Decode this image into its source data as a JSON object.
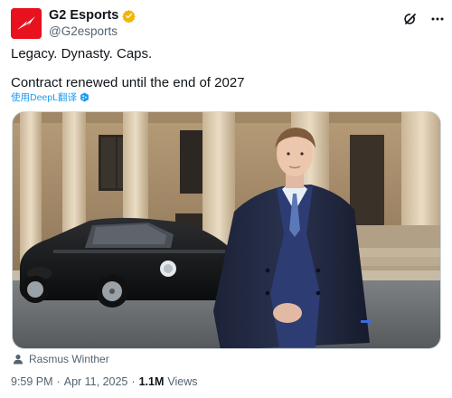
{
  "account": {
    "display_name": "G2 Esports",
    "handle": "@G2esports"
  },
  "tweet": {
    "line1": "Legacy. Dynasty. Caps.",
    "line2": "Contract renewed until the end of 2027",
    "translate_label": "使用DeepL翻译"
  },
  "media": {
    "credit": "Rasmus Winther"
  },
  "footer": {
    "time": "9:59 PM",
    "date": "Apr 11, 2025",
    "separator": "·",
    "views_count": "1.1M",
    "views_label": "Views"
  },
  "icons": {
    "avatar": "g2-logo-icon",
    "verified": "verified-badge-icon",
    "grok": "grok-icon",
    "more": "more-icon",
    "translate": "deepl-icon",
    "credit": "person-icon"
  },
  "colors": {
    "brand": "#e8111e",
    "link": "#1d9bf0",
    "verified": "#f4b400",
    "secondary_text": "#536471"
  }
}
